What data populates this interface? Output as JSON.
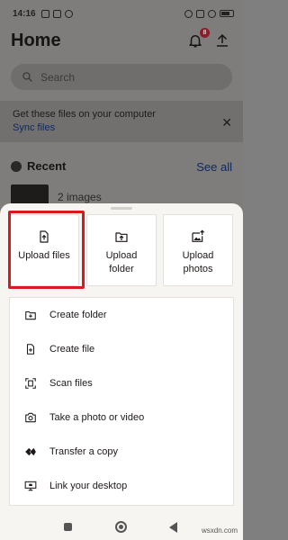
{
  "status_bar": {
    "time": "14:16"
  },
  "home": {
    "title": "Home",
    "notification_count": "8",
    "search_placeholder": "Search",
    "sync_card": {
      "text": "Get these files on your computer",
      "link": "Sync files"
    },
    "recent": {
      "title": "Recent",
      "see_all": "See all",
      "item_label": "2 images"
    }
  },
  "sheet": {
    "tiles": [
      {
        "label": "Upload files",
        "icon": "upload-file-icon"
      },
      {
        "label": "Upload folder",
        "icon": "upload-folder-icon"
      },
      {
        "label": "Upload photos",
        "icon": "upload-photos-icon"
      }
    ],
    "actions": [
      {
        "label": "Create folder",
        "icon": "create-folder-icon"
      },
      {
        "label": "Create file",
        "icon": "create-file-icon"
      },
      {
        "label": "Scan files",
        "icon": "scan-icon"
      },
      {
        "label": "Take a photo or video",
        "icon": "camera-icon"
      },
      {
        "label": "Transfer a copy",
        "icon": "transfer-icon"
      },
      {
        "label": "Link your desktop",
        "icon": "desktop-icon"
      }
    ]
  },
  "watermark": "wsxdn.com",
  "colors": {
    "highlight": "#d8191f",
    "link": "#0d2a63",
    "badge": "#8a1f2a"
  }
}
